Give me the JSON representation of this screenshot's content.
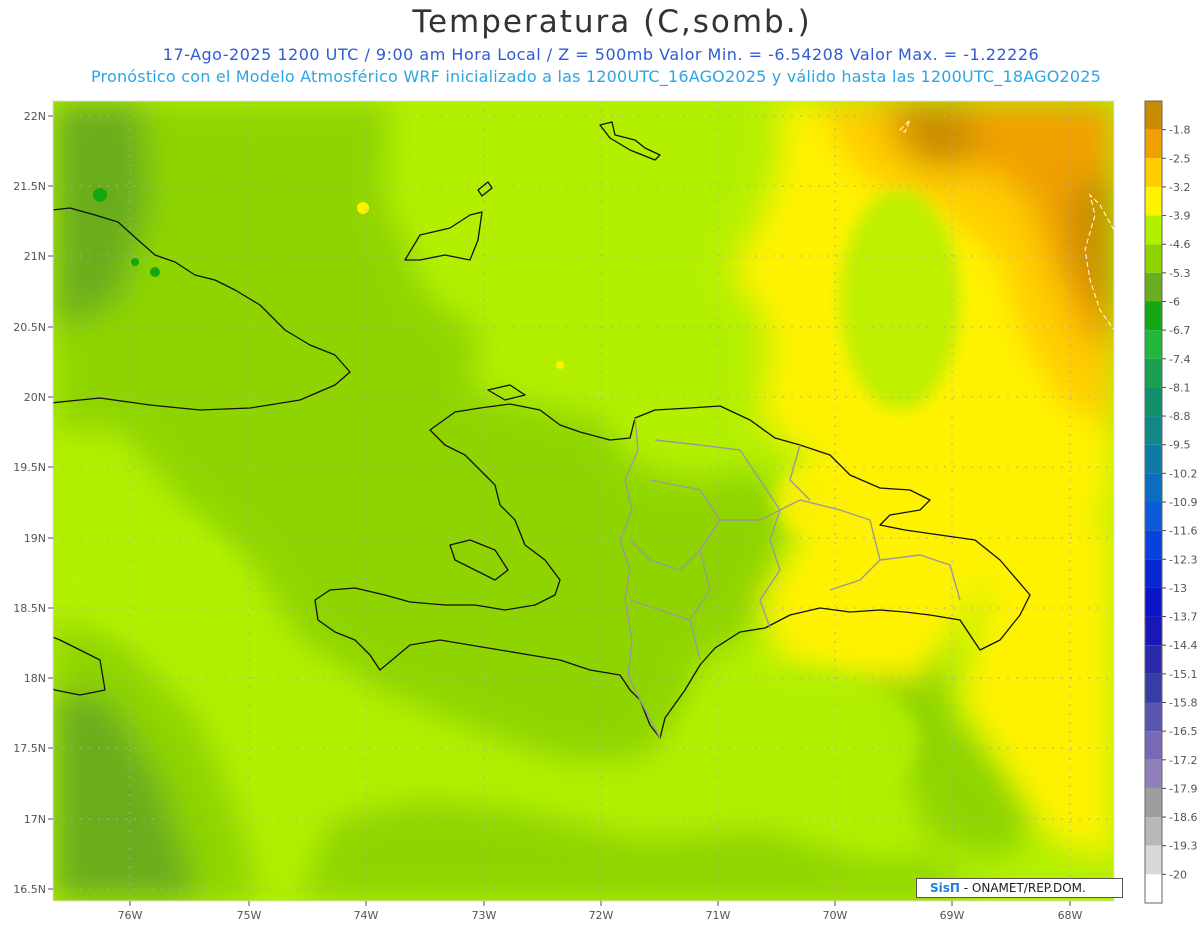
{
  "header": {
    "title": "Temperatura (C,somb.)",
    "subtitle1": "17-Ago-2025  1200 UTC / 9:00 am Hora Local / Z = 500mb  Valor Min. = -6.54208  Valor Max. = -1.22226",
    "subtitle2": "Pronóstico con el Modelo Atmosférico WRF inicializado a las 1200UTC_16AGO2025 y válido hasta las  1200UTC_18AGO2025"
  },
  "axes": {
    "lat_labels": [
      "22N",
      "21.5N",
      "21N",
      "20.5N",
      "20N",
      "19.5N",
      "19N",
      "18.5N",
      "18N",
      "17.5N",
      "17N",
      "16.5N"
    ],
    "lon_labels": [
      "76W",
      "75W",
      "74W",
      "73W",
      "72W",
      "71W",
      "70W",
      "69W",
      "68W"
    ]
  },
  "legend": {
    "levels": [
      {
        "label": "-1.8",
        "color": "#c98c00"
      },
      {
        "label": "-2.5",
        "color": "#f0a000"
      },
      {
        "label": "-3.2",
        "color": "#ffcc00"
      },
      {
        "label": "-3.9",
        "color": "#fff200"
      },
      {
        "label": "-4.6",
        "color": "#b3f000"
      },
      {
        "label": "-5.3",
        "color": "#8fd400"
      },
      {
        "label": "-6",
        "color": "#6aad1e"
      },
      {
        "label": "-6.7",
        "color": "#13a813"
      },
      {
        "label": "-7.4",
        "color": "#1fb83a"
      },
      {
        "label": "-8.1",
        "color": "#1a9f50"
      },
      {
        "label": "-8.8",
        "color": "#138f6a"
      },
      {
        "label": "-9.5",
        "color": "#128786"
      },
      {
        "label": "-10.2",
        "color": "#0f7aa3"
      },
      {
        "label": "-10.9",
        "color": "#0b6cc0"
      },
      {
        "label": "-11.6",
        "color": "#0b5ad6"
      },
      {
        "label": "-12.3",
        "color": "#0a41dc"
      },
      {
        "label": "-13",
        "color": "#0726d4"
      },
      {
        "label": "-13.7",
        "color": "#0b14c8"
      },
      {
        "label": "-14.4",
        "color": "#1a16b8"
      },
      {
        "label": "-15.1",
        "color": "#2d2aaa"
      },
      {
        "label": "-15.8",
        "color": "#3a3ca6"
      },
      {
        "label": "-16.5",
        "color": "#5a56b0"
      },
      {
        "label": "-17.2",
        "color": "#7868b6"
      },
      {
        "label": "-17.9",
        "color": "#9080bd"
      },
      {
        "label": "-18.6",
        "color": "#9e9e9e"
      },
      {
        "label": "-19.3",
        "color": "#b8b8b8"
      },
      {
        "label": "-20",
        "color": "#d8d8d8"
      }
    ],
    "below_color": "#ffffff"
  },
  "credit": {
    "logo": "SisΠ",
    "text": " - ONAMET/REP.DOM."
  }
}
